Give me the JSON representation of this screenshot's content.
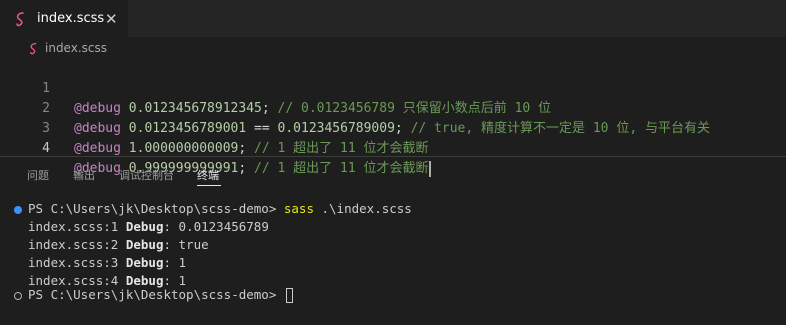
{
  "tab": {
    "filename": "index.scss",
    "close": "✕"
  },
  "breadcrumb": {
    "file": "index.scss"
  },
  "editor": {
    "lines": [
      {
        "number": "1",
        "keyword": "@debug",
        "value": " 0.012345678912345",
        "punct": ";",
        "comment": " // 0.0123456789 只保留小数点后前 10 位"
      },
      {
        "number": "2",
        "keyword": "@debug",
        "value": " 0.0123456789001",
        "operator": " == ",
        "value2": "0.0123456789009",
        "punct": ";",
        "comment": " // true, 精度计算不一定是 10 位, 与平台有关"
      },
      {
        "number": "3",
        "keyword": "@debug",
        "value": " 1.000000000009",
        "punct": ";",
        "comment": " // 1 超出了 11 位才会截断"
      },
      {
        "number": "4",
        "keyword": "@debug",
        "value": " 0.999999999991",
        "punct": ";",
        "comment": " // 1 超出了 11 位才会截断"
      }
    ]
  },
  "panel": {
    "tabs": [
      "问题",
      "输出",
      "调试控制台",
      "终端"
    ],
    "active_tab": "终端"
  },
  "terminal": {
    "prompt": "PS C:\\Users\\jk\\Desktop\\scss-demo> ",
    "command_name": "sass",
    "command_args": " .\\index.scss",
    "outputs": [
      {
        "prefix": "index.scss:1 ",
        "label": "Debug",
        "value": ": 0.0123456789"
      },
      {
        "prefix": "index.scss:2 ",
        "label": "Debug",
        "value": ": true"
      },
      {
        "prefix": "index.scss:3 ",
        "label": "Debug",
        "value": ": 1"
      },
      {
        "prefix": "index.scss:4 ",
        "label": "Debug",
        "value": ": 1"
      }
    ],
    "prompt2": "PS C:\\Users\\jk\\Desktop\\scss-demo> "
  },
  "colors": {
    "sass_icon": "#f55385",
    "accent_dot": "#3794ff"
  }
}
